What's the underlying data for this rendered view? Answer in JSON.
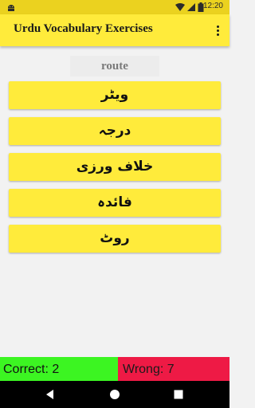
{
  "status_bar": {
    "time": "12:20",
    "icons": [
      "android-icon",
      "wifi-icon",
      "signal-icon",
      "battery-icon"
    ]
  },
  "app_bar": {
    "title": "Urdu Vocabulary Exercises",
    "overflow_icon": "more-vertical-icon"
  },
  "question": {
    "word": "route"
  },
  "options": [
    "ویٹر",
    "درجہ",
    "خلاف ورزی",
    "فائدہ",
    "روٹ"
  ],
  "score": {
    "correct_label": "Correct: 2",
    "wrong_label": "Wrong: 7"
  },
  "nav_bar": {
    "icons": [
      "back-icon",
      "home-icon",
      "recents-icon"
    ]
  },
  "colors": {
    "accent": "#ffeb3b",
    "status_bar": "#ebd21f",
    "correct": "#3cf522",
    "wrong": "#ee1a45"
  }
}
